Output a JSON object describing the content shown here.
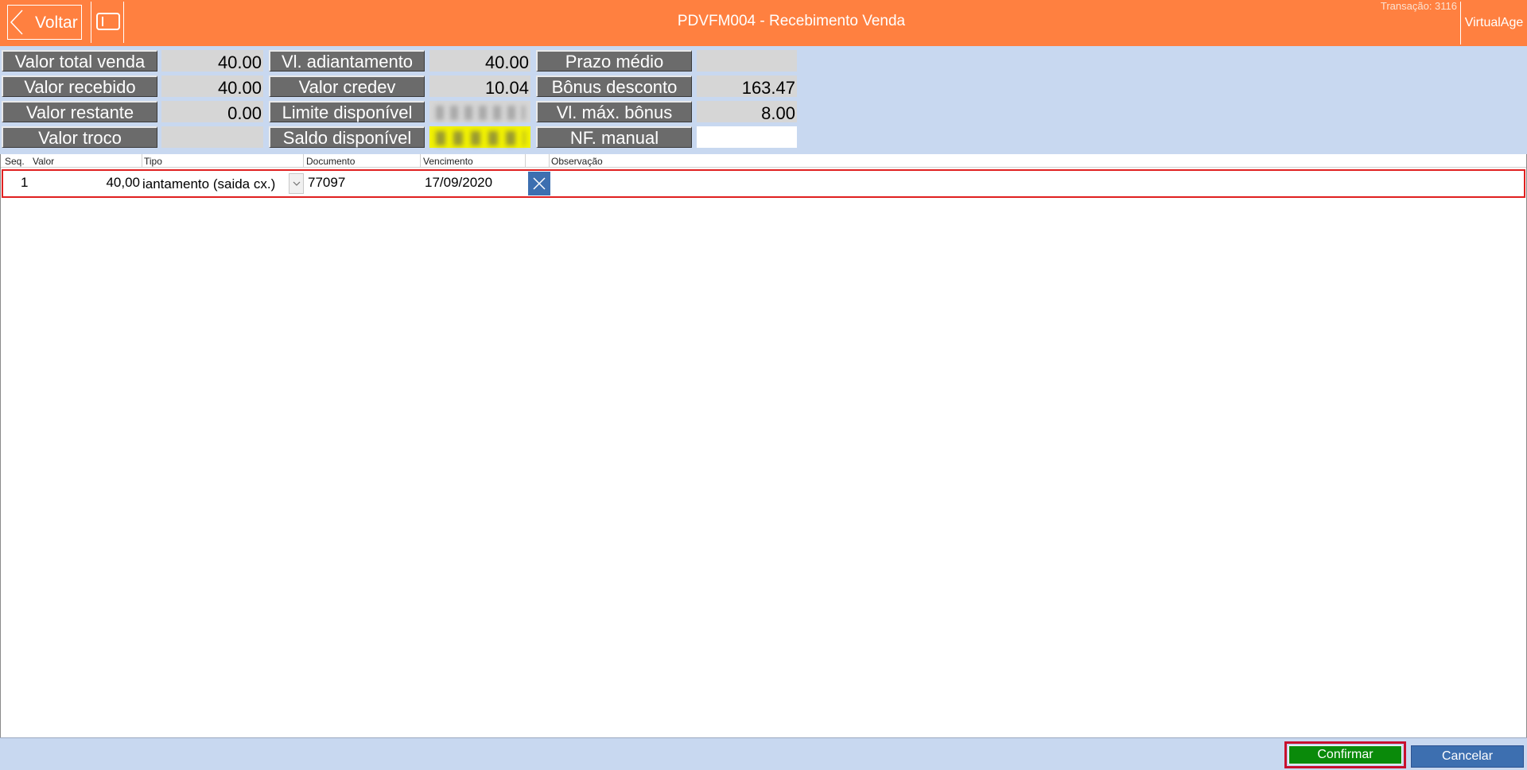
{
  "header": {
    "back_label": "Voltar",
    "title": "PDVFM004 - Recebimento Venda",
    "transaction": "Transação: 3116",
    "right_label": "VirtualAge"
  },
  "summary": {
    "valor_total_venda": {
      "label": "Valor total venda",
      "value": "40.00"
    },
    "valor_recebido": {
      "label": "Valor recebido",
      "value": "40.00"
    },
    "valor_restante": {
      "label": "Valor restante",
      "value": "0.00"
    },
    "valor_troco": {
      "label": "Valor troco",
      "value": ""
    },
    "vl_adiantamento": {
      "label": "Vl. adiantamento",
      "value": "40.00"
    },
    "valor_credev": {
      "label": "Valor credev",
      "value": "10.04"
    },
    "limite_disponivel": {
      "label": "Limite disponível",
      "value": ""
    },
    "saldo_disponivel": {
      "label": "Saldo disponível",
      "value": ""
    },
    "prazo_medio": {
      "label": "Prazo médio",
      "value": ""
    },
    "bonus_desconto": {
      "label": "Bônus desconto",
      "value": "163.47"
    },
    "vl_max_bonus": {
      "label": "Vl. máx. bônus",
      "value": "8.00"
    },
    "nf_manual": {
      "label": "NF. manual",
      "value": ""
    }
  },
  "grid": {
    "columns": [
      "Seq.",
      "Valor",
      "Tipo",
      "Documento",
      "Vencimento",
      "Observação"
    ],
    "rows": [
      {
        "seq": "1",
        "valor": "40,00",
        "tipo": "iantamento (saida cx.)",
        "documento": "77097",
        "vencimento": "17/09/2020",
        "observacao": ""
      }
    ]
  },
  "footer": {
    "confirm_label": "Confirmar",
    "cancel_label": "Cancelar"
  },
  "colors": {
    "header_bg": "#ff8040",
    "panel_bg": "#c8d8f0",
    "label_bg": "#6b6b6b",
    "confirm_bg": "#0a8a0a",
    "cancel_bg": "#3d6fb0",
    "highlight_border": "#e02020",
    "blurred_highlight": "#f2f200"
  },
  "icons": {
    "back": "chevron-left-icon",
    "menu": "panel-toggle-icon",
    "combo": "chevron-down-icon",
    "delete": "close-icon"
  }
}
